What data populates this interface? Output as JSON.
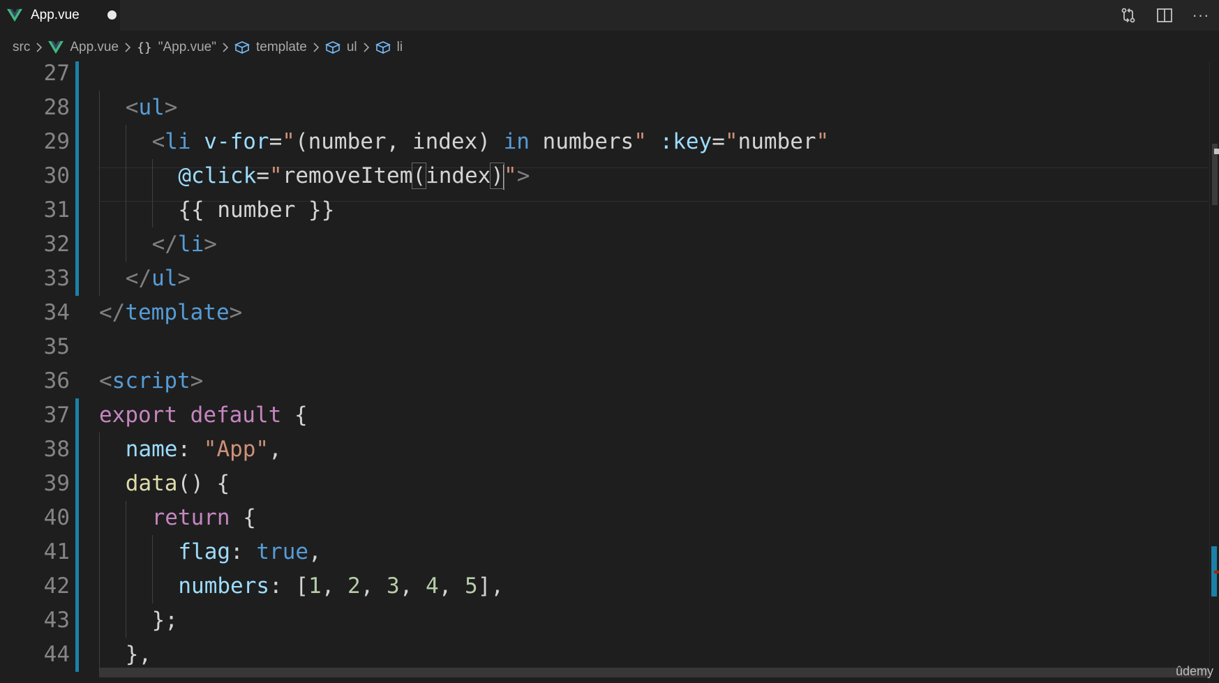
{
  "tab": {
    "label": "App.vue",
    "dirty": true
  },
  "actions": [
    {
      "name": "open-changes-icon"
    },
    {
      "name": "split-editor-icon"
    },
    {
      "name": "more-actions-icon",
      "glyph": "···"
    }
  ],
  "breadcrumb": {
    "items": [
      {
        "label": "src"
      },
      {
        "label": "App.vue"
      },
      {
        "label": "\"App.vue\"",
        "prefix": "{}"
      },
      {
        "label": "template"
      },
      {
        "label": "ul"
      },
      {
        "label": "li"
      }
    ]
  },
  "editor": {
    "line_numbers": [
      "27",
      "28",
      "29",
      "30",
      "31",
      "32",
      "33",
      "34",
      "35",
      "36",
      "37",
      "38",
      "39",
      "40",
      "41",
      "42",
      "43",
      "44"
    ],
    "lines": [
      [],
      [
        [
          "t-punc",
          "<"
        ],
        [
          "t-tag",
          "ul"
        ],
        [
          "t-punc",
          ">"
        ]
      ],
      [
        [
          "t-punc",
          "<"
        ],
        [
          "t-tag",
          "li"
        ],
        [
          "t-text",
          " "
        ],
        [
          "t-attr",
          "v-for"
        ],
        [
          "t-text",
          "="
        ],
        [
          "t-str",
          "\""
        ],
        [
          "t-text",
          "(number, index) "
        ],
        [
          "t-tag",
          "in"
        ],
        [
          "t-text",
          " numbers"
        ],
        [
          "t-str",
          "\""
        ],
        [
          "t-text",
          " "
        ],
        [
          "t-attr",
          ":key"
        ],
        [
          "t-text",
          "="
        ],
        [
          "t-str",
          "\""
        ],
        [
          "t-text",
          "number"
        ],
        [
          "t-str",
          "\""
        ]
      ],
      [
        [
          "t-attr",
          "@click"
        ],
        [
          "t-text",
          "="
        ],
        [
          "t-str",
          "\""
        ],
        [
          "t-text",
          "removeItem"
        ],
        [
          "box",
          "("
        ],
        [
          "t-text",
          "index"
        ],
        [
          "box",
          ")"
        ],
        [
          "caret",
          ""
        ],
        [
          "t-str",
          "\""
        ],
        [
          "t-punc",
          ">"
        ]
      ],
      [
        [
          "t-text",
          "{{ number }}"
        ]
      ],
      [
        [
          "t-punc",
          "</"
        ],
        [
          "t-tag",
          "li"
        ],
        [
          "t-punc",
          ">"
        ]
      ],
      [
        [
          "t-punc",
          "</"
        ],
        [
          "t-tag",
          "ul"
        ],
        [
          "t-punc",
          ">"
        ]
      ],
      [
        [
          "t-punc",
          "</"
        ],
        [
          "t-tag",
          "template"
        ],
        [
          "t-punc",
          ">"
        ]
      ],
      [],
      [
        [
          "t-punc",
          "<"
        ],
        [
          "t-tag",
          "script"
        ],
        [
          "t-punc",
          ">"
        ]
      ],
      [
        [
          "t-kw",
          "export"
        ],
        [
          "t-text",
          " "
        ],
        [
          "t-kw",
          "default"
        ],
        [
          "t-text",
          " {"
        ]
      ],
      [
        [
          "t-prop",
          "name"
        ],
        [
          "t-text",
          ": "
        ],
        [
          "t-str",
          "\"App\""
        ],
        [
          "t-text",
          ","
        ]
      ],
      [
        [
          "t-fn",
          "data"
        ],
        [
          "t-text",
          "() {"
        ]
      ],
      [
        [
          "t-kw",
          "return"
        ],
        [
          "t-text",
          " {"
        ]
      ],
      [
        [
          "t-prop",
          "flag"
        ],
        [
          "t-text",
          ": "
        ],
        [
          "t-bool",
          "true"
        ],
        [
          "t-text",
          ","
        ]
      ],
      [
        [
          "t-prop",
          "numbers"
        ],
        [
          "t-text",
          ": ["
        ],
        [
          "t-num",
          "1"
        ],
        [
          "t-text",
          ", "
        ],
        [
          "t-num",
          "2"
        ],
        [
          "t-text",
          ", "
        ],
        [
          "t-num",
          "3"
        ],
        [
          "t-text",
          ", "
        ],
        [
          "t-num",
          "4"
        ],
        [
          "t-text",
          ", "
        ],
        [
          "t-num",
          "5"
        ],
        [
          "t-text",
          "],"
        ]
      ],
      [
        [
          "t-text",
          "};"
        ]
      ],
      [
        [
          "t-text",
          "},"
        ]
      ]
    ]
  },
  "watermark": "ûdemy"
}
